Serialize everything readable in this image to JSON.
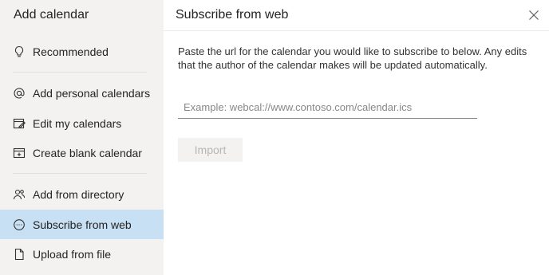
{
  "sidebar": {
    "title": "Add calendar",
    "items": [
      {
        "label": "Recommended",
        "icon": "lightbulb-icon"
      },
      {
        "label": "Add personal calendars",
        "icon": "at-sign-icon"
      },
      {
        "label": "Edit my calendars",
        "icon": "edit-calendar-icon"
      },
      {
        "label": "Create blank calendar",
        "icon": "calendar-add-icon"
      },
      {
        "label": "Add from directory",
        "icon": "people-icon"
      },
      {
        "label": "Subscribe from web",
        "icon": "web-icon",
        "selected": true
      },
      {
        "label": "Upload from file",
        "icon": "file-icon"
      }
    ]
  },
  "main": {
    "title": "Subscribe from web",
    "description": "Paste the url for the calendar you would like to subscribe to below. Any edits that the author of the calendar makes will be updated automatically.",
    "url_input": {
      "value": "",
      "placeholder": "Example: webcal://www.contoso.com/calendar.ics"
    },
    "import_label": "Import",
    "close_icon": "close-icon"
  },
  "colors": {
    "sidebar_bg": "#f3f2f1",
    "selected_bg": "#c7e0f4",
    "text": "#252423",
    "disabled_text": "#b8b6b4"
  }
}
